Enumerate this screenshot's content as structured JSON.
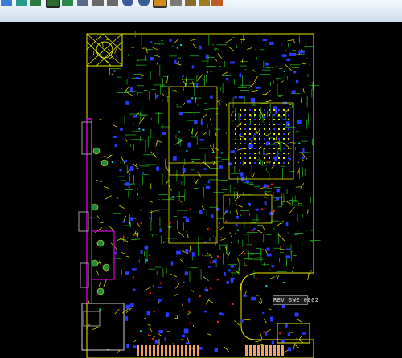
{
  "window": {
    "toolbar_buttons": [
      {
        "icon": "layers-icon",
        "color": "#3b7bd6"
      },
      {
        "icon": "layer-stack-icon",
        "color": "#2a9a8a"
      },
      {
        "icon": "grid-icon",
        "color": "#2c7a3c"
      },
      {
        "icon": "board-view-icon",
        "color": "#2d6a2d"
      },
      {
        "icon": "net-dots-icon",
        "color": "#2a8a4a"
      },
      {
        "icon": "snap-icon",
        "color": "#5a6a8a"
      },
      {
        "icon": "properties-icon",
        "color": "#6a6a6a"
      },
      {
        "icon": "list-icon",
        "color": "#6a6a6a"
      },
      {
        "icon": "zoom-icon",
        "color": "#3b5b9a"
      },
      {
        "icon": "zoom-fit-icon",
        "color": "#3b5b9a"
      },
      {
        "icon": "refresh-icon",
        "color": "#d08a20"
      },
      {
        "icon": "pan-icon",
        "color": "#7a7a7a"
      },
      {
        "icon": "measure-icon",
        "color": "#8a6a2a"
      },
      {
        "icon": "highlight-icon",
        "color": "#a07a20"
      },
      {
        "icon": "export-icon",
        "color": "#c05a20"
      }
    ]
  },
  "board": {
    "silk_label": "REV_SWE_0002",
    "colors": {
      "background": "#000000",
      "outline": "#ffff00",
      "trace_green": "#1fa81f",
      "copper_yellow": "#e8e800",
      "via_blue": "#2a3aff",
      "magenta": "#ff00ff",
      "cyan": "#00d8d8",
      "orange_pad": "#f0a060",
      "red": "#ff2020"
    }
  }
}
